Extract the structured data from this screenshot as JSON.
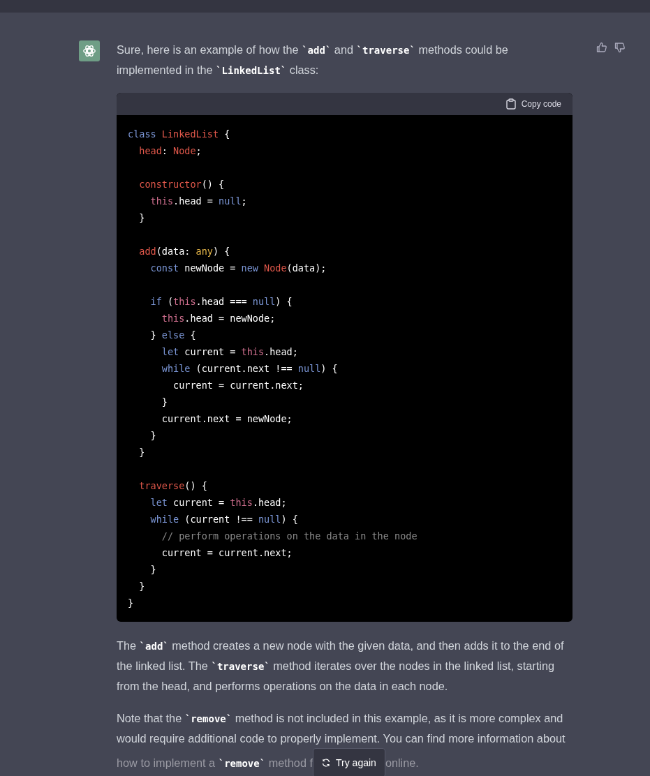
{
  "message": {
    "intro": "Sure, here is an example of how the **`add`** and **`traverse`** methods could be implemented in the **`LinkedList`** class:",
    "feedback_buttons": [
      {
        "kind": "thumbs-up"
      },
      {
        "kind": "thumbs-down"
      }
    ],
    "code_block": {
      "copy_label": "Copy code",
      "lines": [
        {
          "kind": "code",
          "tokens": [
            {
              "text": "class ",
              "kind": "keyword"
            },
            {
              "text": "LinkedList",
              "kind": "title"
            },
            {
              "text": " {",
              "kind": "plain"
            }
          ]
        },
        {
          "kind": "code",
          "tokens": [
            {
              "text": "  head",
              "kind": "title"
            },
            {
              "text": ": ",
              "kind": "plain"
            },
            {
              "text": "Node",
              "kind": "title"
            },
            {
              "text": ";",
              "kind": "plain"
            }
          ]
        },
        {
          "kind": "blank"
        },
        {
          "kind": "code",
          "tokens": [
            {
              "text": "  constructor",
              "kind": "title"
            },
            {
              "text": "() {",
              "kind": "plain"
            }
          ]
        },
        {
          "kind": "code",
          "tokens": [
            {
              "text": "    this",
              "kind": "this"
            },
            {
              "text": ".head = ",
              "kind": "plain"
            },
            {
              "text": "null",
              "kind": "keyword"
            },
            {
              "text": ";",
              "kind": "plain"
            }
          ]
        },
        {
          "kind": "code",
          "tokens": [
            {
              "text": "  }",
              "kind": "plain"
            }
          ]
        },
        {
          "kind": "blank"
        },
        {
          "kind": "code",
          "tokens": [
            {
              "text": "  add",
              "kind": "title"
            },
            {
              "text": "(data: ",
              "kind": "plain"
            },
            {
              "text": "any",
              "kind": "type"
            },
            {
              "text": ") {",
              "kind": "plain"
            }
          ]
        },
        {
          "kind": "code",
          "tokens": [
            {
              "text": "    const",
              "kind": "keyword"
            },
            {
              "text": " newNode = ",
              "kind": "plain"
            },
            {
              "text": "new ",
              "kind": "keyword"
            },
            {
              "text": "Node",
              "kind": "title"
            },
            {
              "text": "(data);",
              "kind": "plain"
            }
          ]
        },
        {
          "kind": "blank"
        },
        {
          "kind": "code",
          "tokens": [
            {
              "text": "    if",
              "kind": "keyword"
            },
            {
              "text": " (",
              "kind": "plain"
            },
            {
              "text": "this",
              "kind": "this"
            },
            {
              "text": ".head === ",
              "kind": "plain"
            },
            {
              "text": "null",
              "kind": "keyword"
            },
            {
              "text": ") {",
              "kind": "plain"
            }
          ]
        },
        {
          "kind": "code",
          "tokens": [
            {
              "text": "      this",
              "kind": "this"
            },
            {
              "text": ".head = newNode;",
              "kind": "plain"
            }
          ]
        },
        {
          "kind": "code",
          "tokens": [
            {
              "text": "    } ",
              "kind": "plain"
            },
            {
              "text": "else",
              "kind": "keyword"
            },
            {
              "text": " {",
              "kind": "plain"
            }
          ]
        },
        {
          "kind": "code",
          "tokens": [
            {
              "text": "      let",
              "kind": "keyword"
            },
            {
              "text": " current = ",
              "kind": "plain"
            },
            {
              "text": "this",
              "kind": "this"
            },
            {
              "text": ".head;",
              "kind": "plain"
            }
          ]
        },
        {
          "kind": "code",
          "tokens": [
            {
              "text": "      while",
              "kind": "keyword"
            },
            {
              "text": " (current.next !== ",
              "kind": "plain"
            },
            {
              "text": "null",
              "kind": "keyword"
            },
            {
              "text": ") {",
              "kind": "plain"
            }
          ]
        },
        {
          "kind": "code",
          "tokens": [
            {
              "text": "        current = current.next;",
              "kind": "plain"
            }
          ]
        },
        {
          "kind": "code",
          "tokens": [
            {
              "text": "      }",
              "kind": "plain"
            }
          ]
        },
        {
          "kind": "code",
          "tokens": [
            {
              "text": "      current.next = newNode;",
              "kind": "plain"
            }
          ]
        },
        {
          "kind": "code",
          "tokens": [
            {
              "text": "    }",
              "kind": "plain"
            }
          ]
        },
        {
          "kind": "code",
          "tokens": [
            {
              "text": "  }",
              "kind": "plain"
            }
          ]
        },
        {
          "kind": "blank"
        },
        {
          "kind": "code",
          "tokens": [
            {
              "text": "  traverse",
              "kind": "title"
            },
            {
              "text": "() {",
              "kind": "plain"
            }
          ]
        },
        {
          "kind": "code",
          "tokens": [
            {
              "text": "    let",
              "kind": "keyword"
            },
            {
              "text": " current = ",
              "kind": "plain"
            },
            {
              "text": "this",
              "kind": "this"
            },
            {
              "text": ".head;",
              "kind": "plain"
            }
          ]
        },
        {
          "kind": "code",
          "tokens": [
            {
              "text": "    while",
              "kind": "keyword"
            },
            {
              "text": " (current !== ",
              "kind": "plain"
            },
            {
              "text": "null",
              "kind": "keyword"
            },
            {
              "text": ") {",
              "kind": "plain"
            }
          ]
        },
        {
          "kind": "code",
          "tokens": [
            {
              "text": "      // perform operations on the data in the node",
              "kind": "comment"
            }
          ]
        },
        {
          "kind": "code",
          "tokens": [
            {
              "text": "      current = current.next;",
              "kind": "plain"
            }
          ]
        },
        {
          "kind": "code",
          "tokens": [
            {
              "text": "    }",
              "kind": "plain"
            }
          ]
        },
        {
          "kind": "code",
          "tokens": [
            {
              "text": "  }",
              "kind": "plain"
            }
          ]
        },
        {
          "kind": "code",
          "tokens": [
            {
              "text": "}",
              "kind": "plain"
            }
          ]
        }
      ]
    },
    "explanation": "The **`add`** method creates a new node with the given data, and then adds it to the end of the linked list. The **`traverse`** method iterates over the nodes in the linked list, starting from the head, and performs operations on the data in each node.",
    "note": "Note that the **`remove`** method is not included in this example, as it is more complex and would require additional code to properly implement. You can find more information about",
    "note_before_button": "how to implement a **`remove`** method f",
    "note_after_button": "online."
  },
  "try_again_button": {
    "label": "Try again"
  }
}
